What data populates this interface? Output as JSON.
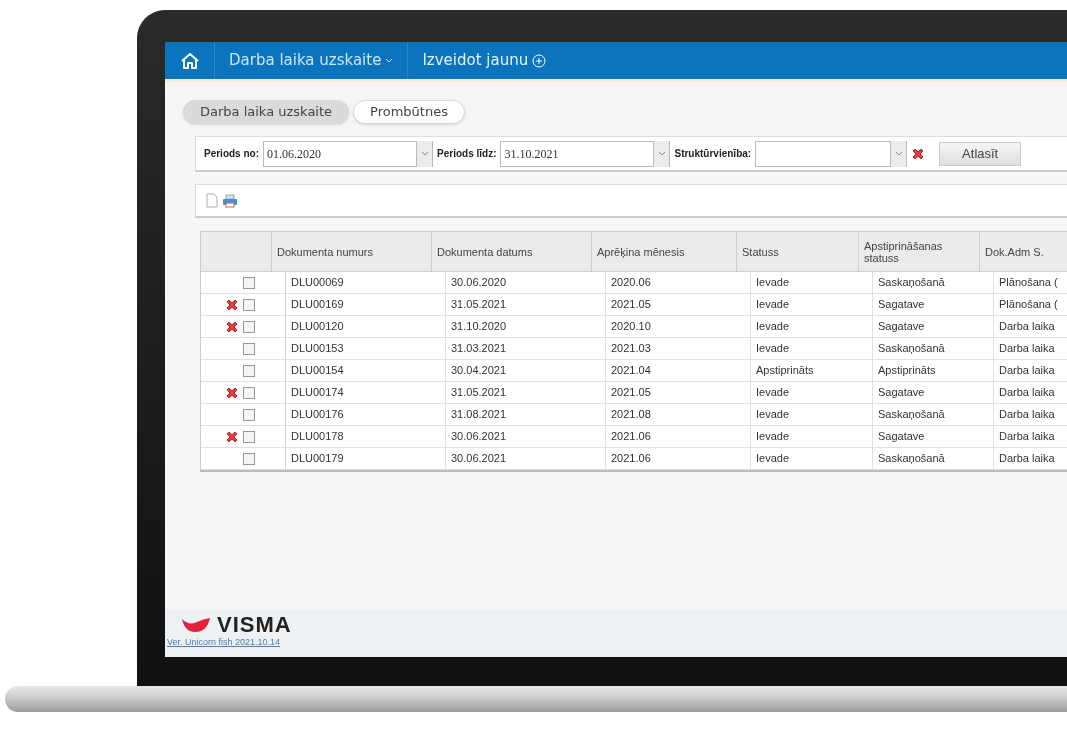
{
  "nav": {
    "items": [
      {
        "label": "Darba laika uzskaite",
        "kind": "dropdown"
      },
      {
        "label": "Izveidot jaunu",
        "kind": "create"
      }
    ]
  },
  "tabs": [
    {
      "label": "Darba laika uzskaite",
      "selected": true
    },
    {
      "label": "Prombūtnes",
      "selected": false
    }
  ],
  "filters": {
    "fields": [
      {
        "label": "Periods no:",
        "value": "01.06.2020"
      },
      {
        "label": "Periods līdz:",
        "value": "31.10.2021"
      },
      {
        "label": "Struktūrvienība:",
        "clearable": true
      }
    ],
    "button": "Atlasīt"
  },
  "table": {
    "columns": [
      "Dokumenta numurs",
      "Dokumenta datums",
      "Aprēķina mēnesis",
      "Statuss",
      "Apstiprināšanas statuss",
      "Dok.Adm S."
    ],
    "rows": [
      {
        "deletable": false,
        "checked": false,
        "cells": [
          "DLU00069",
          "30.06.2020",
          "2020.06",
          "Ievade",
          "Saskaņošanā",
          "Plānošana ("
        ]
      },
      {
        "deletable": true,
        "checked": false,
        "cells": [
          "DLU00169",
          "31.05.2021",
          "2021.05",
          "Ievade",
          "Sagatave",
          "Plānošana ("
        ]
      },
      {
        "deletable": true,
        "checked": false,
        "cells": [
          "DLU00120",
          "31.10.2020",
          "2020.10",
          "Ievade",
          "Sagatave",
          "Darba laika"
        ]
      },
      {
        "deletable": false,
        "checked": false,
        "cells": [
          "DLU00153",
          "31.03.2021",
          "2021.03",
          "Ievade",
          "Saskaņošanā",
          "Darba laika"
        ]
      },
      {
        "deletable": false,
        "checked": false,
        "cells": [
          "DLU00154",
          "30.04.2021",
          "2021.04",
          "Apstiprināts",
          "Apstiprināts",
          "Darba laika"
        ]
      },
      {
        "deletable": true,
        "checked": false,
        "cells": [
          "DLU00174",
          "31.05.2021",
          "2021.05",
          "Ievade",
          "Sagatave",
          "Darba laika"
        ]
      },
      {
        "deletable": false,
        "checked": false,
        "cells": [
          "DLU00176",
          "31.08.2021",
          "2021.08",
          "Ievade",
          "Saskaņošanā",
          "Darba laika"
        ]
      },
      {
        "deletable": true,
        "checked": false,
        "cells": [
          "DLU00178",
          "30.06.2021",
          "2021.06",
          "Ievade",
          "Sagatave",
          "Darba laika"
        ]
      },
      {
        "deletable": false,
        "checked": false,
        "cells": [
          "DLU00179",
          "30.06.2021",
          "2021.06",
          "Ievade",
          "Saskaņošanā",
          "Darba laika"
        ]
      }
    ]
  },
  "footer": {
    "logo": "VISMA",
    "version": "Ver. Unicorn fish 2021.10.14"
  }
}
